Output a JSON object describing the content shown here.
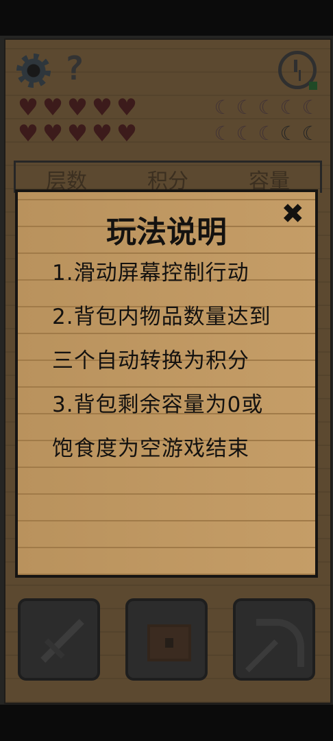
{
  "top": {
    "settings_icon": "gear-icon",
    "help_label": "?",
    "history_icon": "clock-history-icon"
  },
  "status": {
    "hearts_full": 10,
    "hearts_total": 10,
    "food_full": 8,
    "food_total": 10,
    "heart_glyph": "♥",
    "food_glyph": "☾"
  },
  "tabs": [
    "层数",
    "积分",
    "容量"
  ],
  "modal": {
    "title": "玩法说明",
    "close_label": "✖",
    "rules": [
      "1.滑动屏幕控制行动",
      "2.背包内物品数量达到三个自动转换为积分",
      "3.背包剩余容量为0或饱食度为空游戏结束"
    ]
  },
  "toolbar": {
    "slots": [
      "sword-icon",
      "chest-icon",
      "pickaxe-icon"
    ]
  },
  "colors": {
    "board": "#b48a52",
    "modal_bg": "#c39a62",
    "heart": "#6e2424",
    "accent_green": "#2f8a3c"
  }
}
